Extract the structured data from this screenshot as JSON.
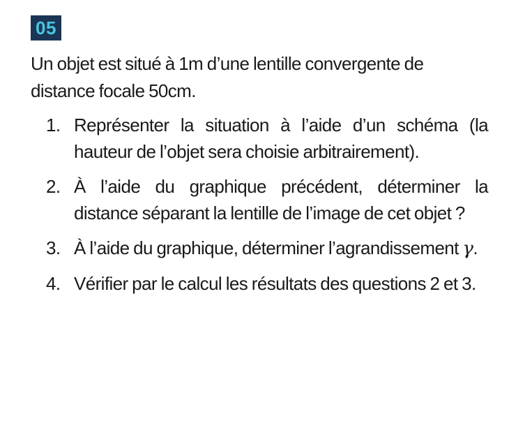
{
  "exercise": {
    "number": "05",
    "statement": "Un objet est situé à 1m d’une lentille convergente de distance focale 50cm.",
    "questions": [
      {
        "number": "1.",
        "text": "Représenter la situation à l’aide d’un schéma (la hauteur de l’objet sera choisie arbitrairement)."
      },
      {
        "number": "2.",
        "text": "À l’aide du graphique précédent, déterminer la distance séparant la lentille de l’image de cet objet ?"
      },
      {
        "number": "3.",
        "text_before": "À l’aide du graphique, déterminer l’agrandissement ",
        "symbol": "γ",
        "text_after": "."
      },
      {
        "number": "4.",
        "text": "Vérifier par le calcul les résultats des questions 2 et 3."
      }
    ]
  },
  "colors": {
    "badge_background": "#1a3654",
    "badge_text": "#4ac4e0",
    "text": "#1a1a1a"
  }
}
